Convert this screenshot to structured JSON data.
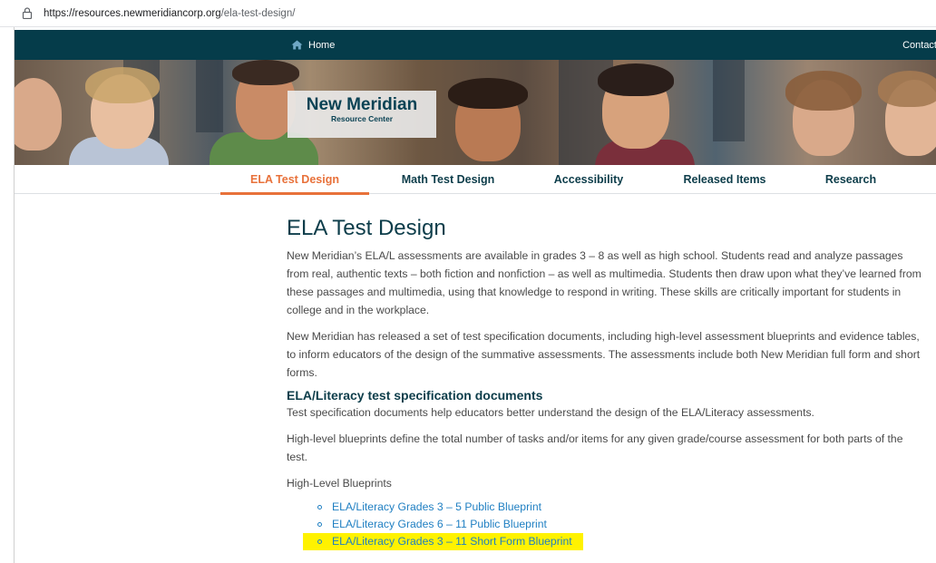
{
  "browser": {
    "url_host": "https://resources.newmeridiancorp.org",
    "url_path": "/ela-test-design/"
  },
  "topbar": {
    "home_label": "Home",
    "contact_label": "Contact"
  },
  "brand": {
    "title": "New Meridian",
    "subtitle": "Resource Center"
  },
  "tabs": [
    {
      "label": "ELA Test Design",
      "active": true
    },
    {
      "label": "Math Test Design",
      "active": false
    },
    {
      "label": "Accessibility",
      "active": false
    },
    {
      "label": "Released Items",
      "active": false
    },
    {
      "label": "Research",
      "active": false
    }
  ],
  "main": {
    "title": "ELA Test Design",
    "para1": "New Meridian’s ELA/L assessments are available in grades 3 – 8 as well as high school. Students read and analyze passages from real, authentic texts – both fiction and nonfiction – as well as multimedia. Students then draw upon what they’ve learned from these passages and multimedia, using that knowledge to respond in writing. These skills are critically important for students in college and in the workplace.",
    "para2": "New Meridian has released a set of test specification documents, including high-level assessment blueprints and evidence tables, to inform educators of the design of the summative assessments. The assessments include both New Meridian full form and short forms.",
    "section_title": "ELA/Literacy test specification documents",
    "para3": "Test specification documents help educators better understand the design of the ELA/Literacy assessments.",
    "para4": "High-level blueprints define the total number of tasks and/or items for any given grade/course assessment for both parts of the test.",
    "blueprints_label": "High-Level Blueprints",
    "links": [
      "ELA/Literacy Grades 3 – 5 Public Blueprint",
      "ELA/Literacy Grades 6 – 11 Public Blueprint",
      "ELA/Literacy Grades 3 – 11 Short Form Blueprint"
    ]
  },
  "colors": {
    "topbar": "#053c4a",
    "accent": "#e8713a",
    "heading": "#0d3d4a",
    "link": "#1f7fc2",
    "highlight": "#fff200"
  }
}
